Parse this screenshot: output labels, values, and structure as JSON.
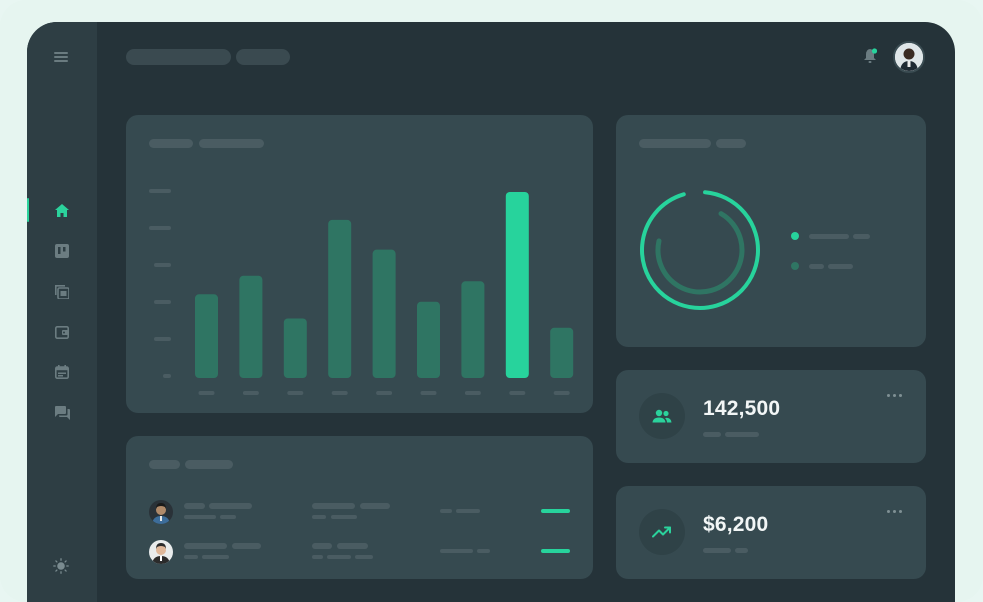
{
  "colors": {
    "accent": "#27d39c",
    "bar_muted": "#2f7563",
    "background": "#253339",
    "card": "#364a50",
    "sidebar": "#2e3e44"
  },
  "header": {
    "icons": [
      "bell-icon",
      "user-avatar"
    ]
  },
  "sidebar": {
    "items": [
      {
        "icon": "home-icon",
        "active": true
      },
      {
        "icon": "board-icon",
        "active": false
      },
      {
        "icon": "gallery-icon",
        "active": false
      },
      {
        "icon": "wallet-icon",
        "active": false
      },
      {
        "icon": "calendar-icon",
        "active": false
      },
      {
        "icon": "chat-icon",
        "active": false
      }
    ],
    "footer_icon": "sun-icon"
  },
  "chart_data": {
    "type": "bar",
    "values": [
      45,
      55,
      32,
      85,
      69,
      41,
      52,
      100,
      27
    ],
    "highlight_index": 7,
    "ylim": [
      0,
      100
    ],
    "grid": false,
    "legend": "none"
  },
  "donut": {
    "outer_fraction": 0.94,
    "inner_fraction": 0.7
  },
  "stats": [
    {
      "value": "142,500",
      "icon": "users-icon"
    },
    {
      "value": "$6,200",
      "icon": "trending-up-icon"
    }
  ],
  "table": {
    "rows": [
      {
        "avatar": "avatar-1",
        "progress": 1.0
      },
      {
        "avatar": "avatar-2",
        "progress": 1.0
      }
    ]
  }
}
